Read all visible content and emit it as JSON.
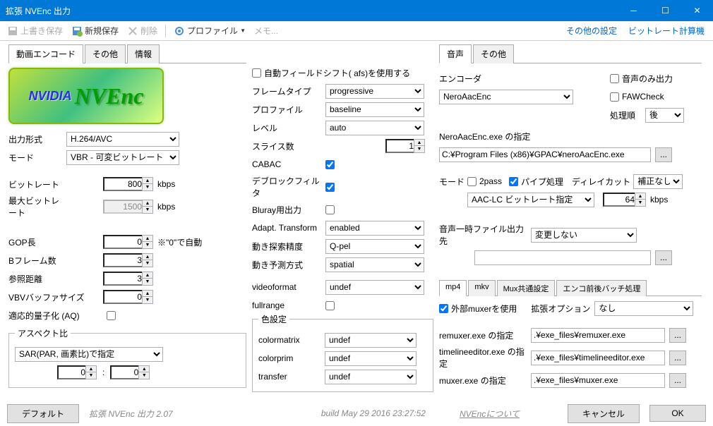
{
  "window": {
    "title": "拡張 NVEnc 出力"
  },
  "toolbar": {
    "overwrite_save": "上書き保存",
    "new_save": "新規保存",
    "delete": "削除",
    "profile": "プロファイル",
    "memo": "メモ...",
    "other_settings": "その他の設定",
    "bitrate_calc": "ビットレート計算機"
  },
  "tabs_main": {
    "video": "動画エンコード",
    "other": "その他",
    "info": "情報"
  },
  "left": {
    "output_format_lbl": "出力形式",
    "output_format": "H.264/AVC",
    "mode_lbl": "モード",
    "mode": "VBR - 可変ビットレート",
    "bitrate_lbl": "ビットレート",
    "bitrate": "800",
    "kbps": "kbps",
    "max_bitrate_lbl": "最大ビットレート",
    "max_bitrate": "1500",
    "gop_lbl": "GOP長",
    "gop": "0",
    "gop_note": "※\"0\"で自動",
    "bframes_lbl": "Bフレーム数",
    "bframes": "3",
    "ref_lbl": "参照距離",
    "ref": "3",
    "vbv_lbl": "VBVバッファサイズ",
    "vbv": "0",
    "aq_lbl": "適応的量子化 (AQ)",
    "aspect_legend": "アスペクト比",
    "aspect_mode": "SAR(PAR, 画素比)で指定",
    "aspect_a": "0",
    "aspect_b": "0",
    "aspect_colon": ":"
  },
  "mid": {
    "afs_lbl": "自動フィールドシフト( afs)を使用する",
    "frametype_lbl": "フレームタイプ",
    "frametype": "progressive",
    "profile_lbl": "プロファイル",
    "profile": "baseline",
    "level_lbl": "レベル",
    "level": "auto",
    "slices_lbl": "スライス数",
    "slices": "1",
    "cabac_lbl": "CABAC",
    "deblock_lbl": "デブロックフィルタ",
    "bluray_lbl": "Bluray用出力",
    "adapt_lbl": "Adapt. Transform",
    "adapt": "enabled",
    "mv_precision_lbl": "動き探索精度",
    "mv_precision": "Q-pel",
    "mv_predict_lbl": "動き予測方式",
    "mv_predict": "spatial",
    "videoformat_lbl": "videoformat",
    "videoformat": "undef",
    "fullrange_lbl": "fullrange",
    "color_legend": "色設定",
    "colormatrix_lbl": "colormatrix",
    "colormatrix": "undef",
    "colorprim_lbl": "colorprim",
    "colorprim": "undef",
    "transfer_lbl": "transfer",
    "transfer": "undef"
  },
  "right": {
    "tabs": {
      "audio": "音声",
      "other": "その他"
    },
    "encoder_lbl": "エンコーダ",
    "encoder": "NeroAacEnc",
    "audio_only_lbl": "音声のみ出力",
    "fawcheck_lbl": "FAWCheck",
    "order_lbl": "処理順",
    "order": "後",
    "exe_lbl": "NeroAacEnc.exe の指定",
    "exe_path": "C:¥Program Files (x86)¥GPAC¥neroAacEnc.exe",
    "mode_lbl": "モード",
    "twopass_lbl": "2pass",
    "pipe_lbl": "パイプ処理",
    "delaycut_lbl": "ディレイカット",
    "delaycut": "補正なし",
    "aac_mode": "AAC-LC ビットレート指定",
    "aac_bitrate": "64",
    "kbps": "kbps",
    "temp_out_lbl": "音声一時ファイル出力先",
    "temp_out": "変更しない",
    "temp_path": "",
    "mux_tabs": {
      "mp4": "mp4",
      "mkv": "mkv",
      "mux_common": "Mux共通設定",
      "batch": "エンコ前後バッチ処理"
    },
    "ext_muxer_lbl": "外部muxerを使用",
    "ext_opts_lbl": "拡張オプション",
    "ext_opts": "なし",
    "remuxer_lbl": "remuxer.exe の指定",
    "remuxer": ".¥exe_files¥remuxer.exe",
    "timeline_lbl": "timelineeditor.exe の指定",
    "timeline": ".¥exe_files¥timelineeditor.exe",
    "muxer_lbl": "muxer.exe の指定",
    "muxer": ".¥exe_files¥muxer.exe"
  },
  "footer": {
    "default": "デフォルト",
    "version": "拡張 NVEnc 出力 2.07",
    "build": "build May 29 2016 23:27:52",
    "about": "NVEncについて",
    "cancel": "キャンセル",
    "ok": "OK"
  }
}
